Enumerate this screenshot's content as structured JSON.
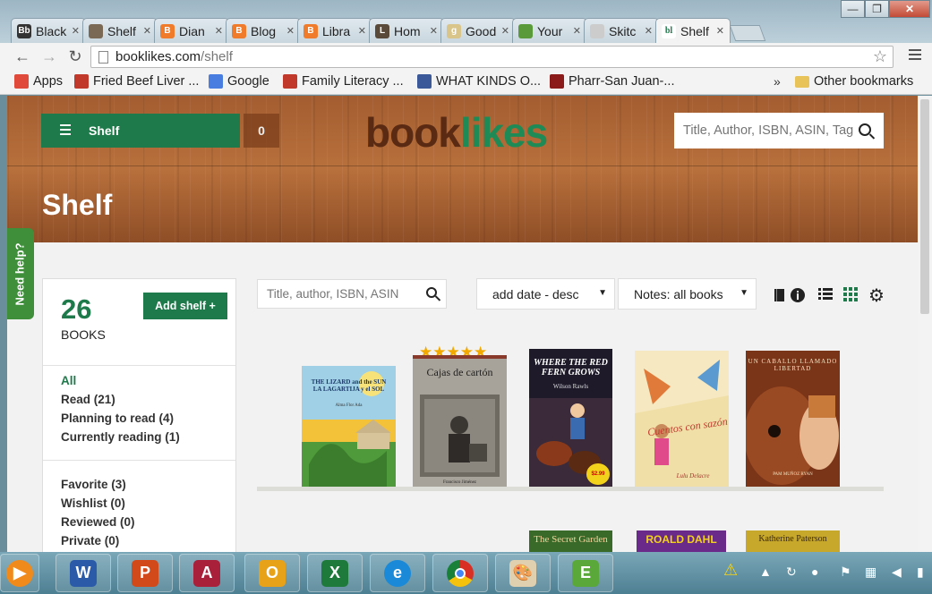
{
  "tabs": [
    {
      "label": "Black",
      "icon": "blackboard-icon",
      "color": "#333333",
      "glyph": "Bb"
    },
    {
      "label": "Shelf",
      "icon": "photo-icon",
      "color": "#7a6a55",
      "glyph": ""
    },
    {
      "label": "Dian",
      "icon": "blogger-icon",
      "color": "#f07b2a",
      "glyph": "B"
    },
    {
      "label": "Blog",
      "icon": "blogger-icon",
      "color": "#f07b2a",
      "glyph": "B"
    },
    {
      "label": "Libra",
      "icon": "blogger-icon",
      "color": "#f07b2a",
      "glyph": "B"
    },
    {
      "label": "Hom",
      "icon": "librarything-icon",
      "color": "#5a4a3a",
      "glyph": "L"
    },
    {
      "label": "Good",
      "icon": "goodreads-icon",
      "color": "#d9c48a",
      "glyph": "g"
    },
    {
      "label": "Your",
      "icon": "bookmark-icon",
      "color": "#5a9a3a",
      "glyph": ""
    },
    {
      "label": "Skitc",
      "icon": "page-icon",
      "color": "#cccccc",
      "glyph": ""
    },
    {
      "label": "Shelf",
      "icon": "booklikes-icon",
      "color": "#ffffff",
      "glyph": "bl",
      "active": true
    }
  ],
  "address": {
    "domain": "booklikes.com",
    "path": "/shelf"
  },
  "bookmarks": [
    {
      "label": "Apps",
      "icon": "apps-grid-icon",
      "color": "#e04a3a"
    },
    {
      "label": "Fried Beef Liver ...",
      "icon": "heart-bookmark-icon",
      "color": "#c0392b"
    },
    {
      "label": "Google",
      "icon": "google-icon",
      "color": "#4a7de0"
    },
    {
      "label": "Family Literacy ...",
      "icon": "literacy-icon",
      "color": "#c0392b"
    },
    {
      "label": "WHAT KINDS O...",
      "icon": "f-circle-icon",
      "color": "#3b5998"
    },
    {
      "label": "Pharr-San Juan-...",
      "icon": "school-icon",
      "color": "#8b1a1a"
    }
  ],
  "bookmarks_more": "»",
  "other_bookmarks": "Other bookmarks",
  "header": {
    "shelf_button": "Shelf",
    "count": "0",
    "logo_a": "book",
    "logo_b": "likes",
    "search_placeholder": "Title, Author, ISBN, ASIN, Tag",
    "page_title": "Shelf"
  },
  "help_tab": "Need help?",
  "sidebar": {
    "count": "26",
    "count_label": "BOOKS",
    "add_shelf": "Add shelf +",
    "status_items": [
      "All",
      "Read (21)",
      "Planning to read (4)",
      "Currently reading (1)"
    ],
    "shelf_items": [
      "Favorite (3)",
      "Wishlist (0)",
      "Reviewed (0)",
      "Private (0)"
    ]
  },
  "controls": {
    "list_search_placeholder": "Title, author, ISBN, ASIN",
    "sort": "add date - desc",
    "notes": "Notes: all books"
  },
  "stars": "★★★★★",
  "books": [
    {
      "title": "THE LIZARD and the SUN\nLA LAGARTIJA y el SOL",
      "author": "Alma Flor Ada",
      "bg": "#f3c238"
    },
    {
      "title": "Cajas de cartón",
      "author": "Francisco Jiménez",
      "bg": "#a8a39a"
    },
    {
      "title": "WHERE THE RED FERN GROWS",
      "author": "Wilson Rawls",
      "bg": "#1e1a2a",
      "badge": "$2.99"
    },
    {
      "title": "Cuentos con sazón",
      "author": "Lulu Delacre",
      "bg": "#f1dfa8"
    },
    {
      "title": "UN CABALLO LLAMADO LIBERTAD",
      "author": "PAM MUÑOZ RYAN",
      "bg": "#8a3a1e"
    },
    {
      "title": "The Secret Garden",
      "author": "",
      "bg": "#3a6a2a"
    },
    {
      "title": "ROALD DAHL",
      "author": "",
      "bg": "#6a2a8a"
    },
    {
      "title": "Katherine Paterson",
      "author": "",
      "bg": "#c8a82a"
    }
  ]
}
